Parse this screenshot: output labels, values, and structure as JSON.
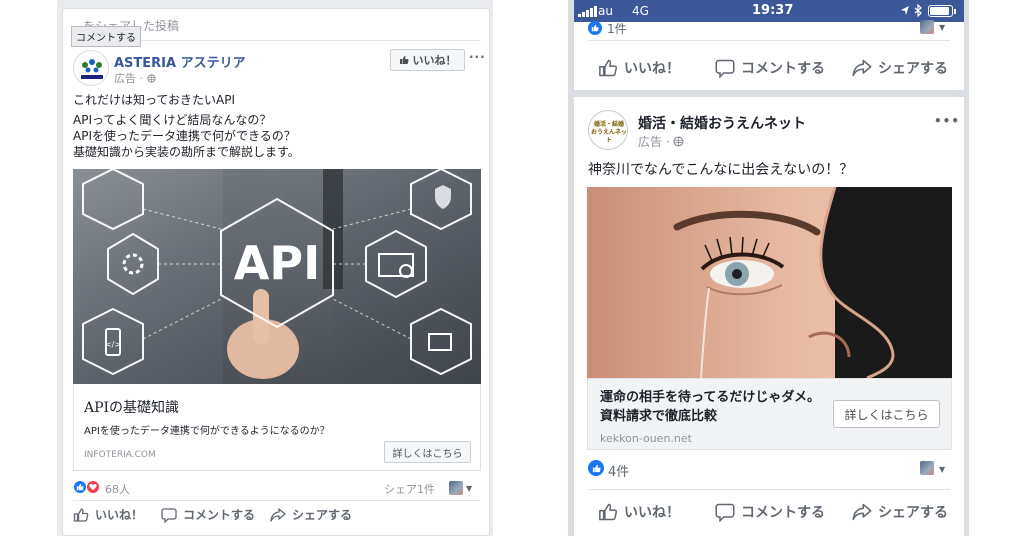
{
  "desktop_ad": {
    "header_partial": "…をシェアした投稿",
    "tooltip": "コメントする",
    "advertiser": "ASTERIA アステリア",
    "sponsored": "広告 ·",
    "like_page_button": "いいね！",
    "more": "···",
    "headline": "これだけは知っておきたいAPI",
    "body_lines": [
      "APIってよく聞くけど結局なんなの？",
      "APIを使ったデータ連携で何ができるの？",
      "基礎知識から実装の勘所まで解説します。"
    ],
    "image_text": "API",
    "link_title": "APIの基礎知識",
    "link_description": "APIを使ったデータ連携で何ができるようになるのか？",
    "link_domain": "INFOTERIA.COM",
    "cta": "詳しくはこちら",
    "reaction_count": "68人",
    "share_count": "シェア1件",
    "actions": {
      "like": "いいね！",
      "comment": "コメントする",
      "share": "シェアする"
    },
    "colors": {
      "link": "#365899",
      "like_blue": "#1877f2",
      "love_red": "#f33e58"
    }
  },
  "mobile_ad": {
    "status_bar": {
      "carrier": "au",
      "network": "4G",
      "time": "19:37"
    },
    "prev_post": {
      "reaction_count": "1件",
      "actions": {
        "like": "いいね！",
        "comment": "コメントする",
        "share": "シェアする"
      }
    },
    "advertiser": "婚活・結婚おうえんネット",
    "logo_text": "婚活・結婚 おうえんネット",
    "sponsored": "広告 ·",
    "more": "•••",
    "body": "神奈川でなんでこんなに出会えないの！？",
    "link_title": "運命の相手を待ってるだけじゃダメ。資料請求で徹底比較",
    "link_domain": "kekkon-ouen.net",
    "cta": "詳しくはこちら",
    "reaction_count": "4件",
    "actions": {
      "like": "いいね！",
      "comment": "コメントする",
      "share": "シェアする"
    },
    "colors": {
      "status_bar": "#3b5998"
    }
  }
}
